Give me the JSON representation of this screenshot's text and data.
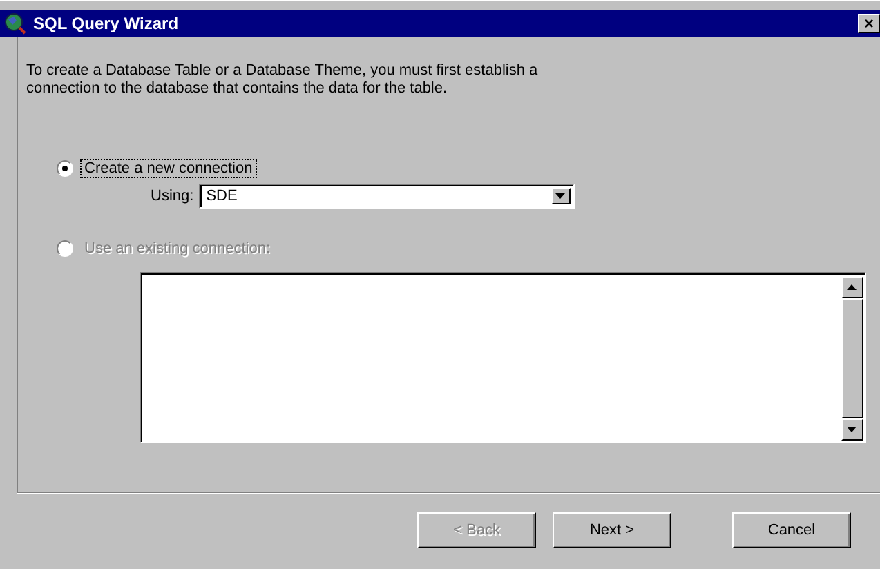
{
  "window": {
    "title": "SQL Query Wizard",
    "close": "×"
  },
  "intro": "To create a Database Table or a Database Theme, you must first establish a connection to the database that contains the data for the table.",
  "options": [
    {
      "label": "Create a new connection",
      "selected": true,
      "disabled": false,
      "focused": true
    },
    {
      "label": "Use an existing connection:",
      "selected": false,
      "disabled": true,
      "focused": false
    }
  ],
  "using": {
    "label": "Using:",
    "value": "SDE"
  },
  "buttons": [
    {
      "label": "< Back",
      "disabled": true
    },
    {
      "label": "Next >",
      "disabled": false
    },
    {
      "label": "Cancel",
      "disabled": false
    }
  ]
}
